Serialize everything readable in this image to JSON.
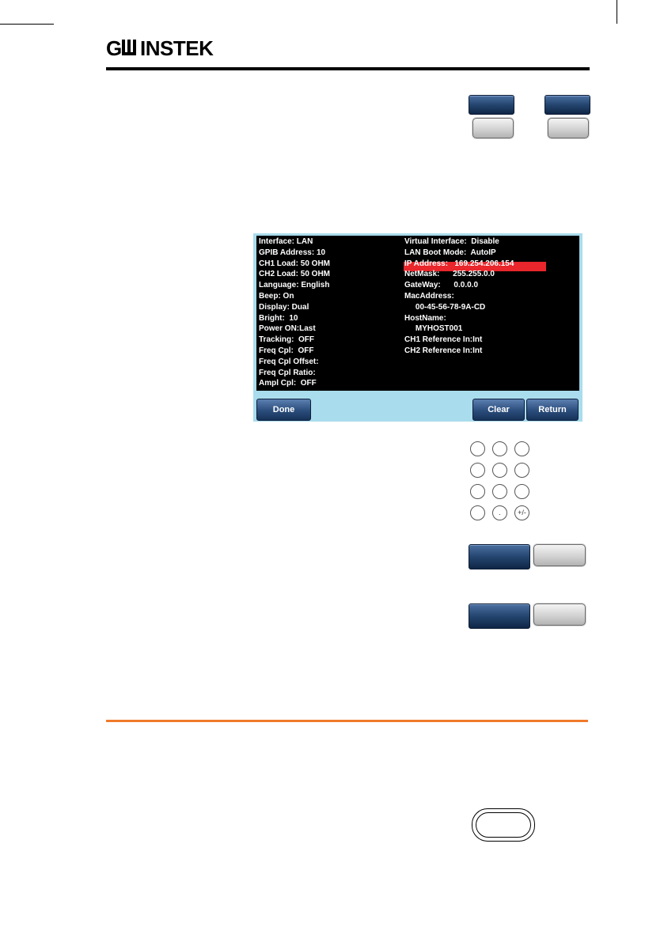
{
  "brand": {
    "logo_text": "GW INSTEK"
  },
  "screen": {
    "left_column": [
      "Interface: LAN",
      "GPIB Address: 10",
      "CH1 Load: 50 OHM",
      "CH2 Load: 50 OHM",
      "Language: English",
      "Beep: On",
      "Display: Dual",
      "Bright:  10",
      "Power ON:Last",
      "Tracking:  OFF",
      "Freq Cpl:  OFF",
      "Freq Cpl Offset:",
      "Freq Cpl Ratio:",
      "Ampl Cpl:  OFF"
    ],
    "right_column": [
      "Virtual Interface:  Disable",
      "LAN Boot Mode:  AutoIP",
      "IP Address:   169.254.206.154",
      "NetMask:      255.255.0.0",
      "GateWay:      0.0.0.0",
      "MacAddress:",
      "     00-45-56-78-9A-CD",
      "HostName:",
      "     MYHOST001",
      "CH1 Reference In:Int",
      "CH2 Reference In:Int"
    ],
    "highlight_row_index": 2,
    "softkeys": {
      "done": "Done",
      "clear": "Clear",
      "return": "Return"
    }
  },
  "keypad": {
    "keys": [
      "",
      "",
      "",
      "",
      "",
      "",
      "",
      "",
      "",
      "",
      ".",
      "+/-"
    ]
  },
  "colors": {
    "screen_frame": "#a9dcec",
    "highlight": "#e8262b",
    "section_rule": "#f07a2b",
    "softkey": "#24456f"
  }
}
